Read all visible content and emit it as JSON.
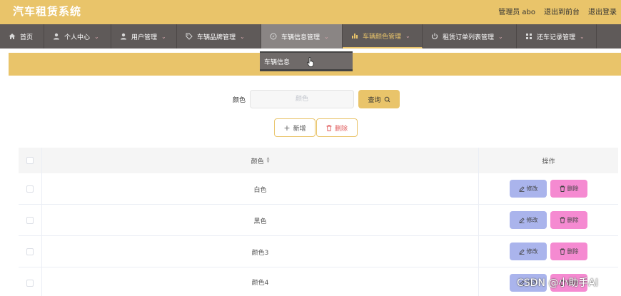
{
  "header": {
    "title": "汽车租赁系统",
    "admin_label": "管理员 abo",
    "back_to_front": "退出到前台",
    "logout": "退出登录"
  },
  "nav": {
    "items": [
      {
        "label": "首页",
        "icon": "home-icon"
      },
      {
        "label": "个人中心",
        "icon": "user-icon"
      },
      {
        "label": "用户管理",
        "icon": "user-icon"
      },
      {
        "label": "车辆品牌管理",
        "icon": "tag-icon"
      },
      {
        "label": "车辆信息管理",
        "icon": "compass-icon"
      },
      {
        "label": "车辆颜色管理",
        "icon": "bar-chart-icon"
      },
      {
        "label": "租赁订单列表管理",
        "icon": "power-icon"
      },
      {
        "label": "还车记录管理",
        "icon": "grid-icon"
      }
    ],
    "hovered_index": 4,
    "active_index": 5,
    "dropdown_item": "车辆信息"
  },
  "search": {
    "label": "颜色",
    "placeholder": "颜色",
    "query_label": "查询"
  },
  "actions": {
    "add_label": "新增",
    "delete_label": "删除"
  },
  "table": {
    "col_color": "颜色",
    "col_ops": "操作",
    "edit_label": "修改",
    "delete_label": "删除",
    "rows": [
      "白色",
      "黑色",
      "颜色3",
      "颜色4"
    ]
  },
  "watermark": "CSDN @小助手AI",
  "colors": {
    "accent": "#e9c46a",
    "nav_bg": "#5f5a59",
    "edit_btn": "#aab4ec",
    "delete_btn": "#f58ad1"
  }
}
